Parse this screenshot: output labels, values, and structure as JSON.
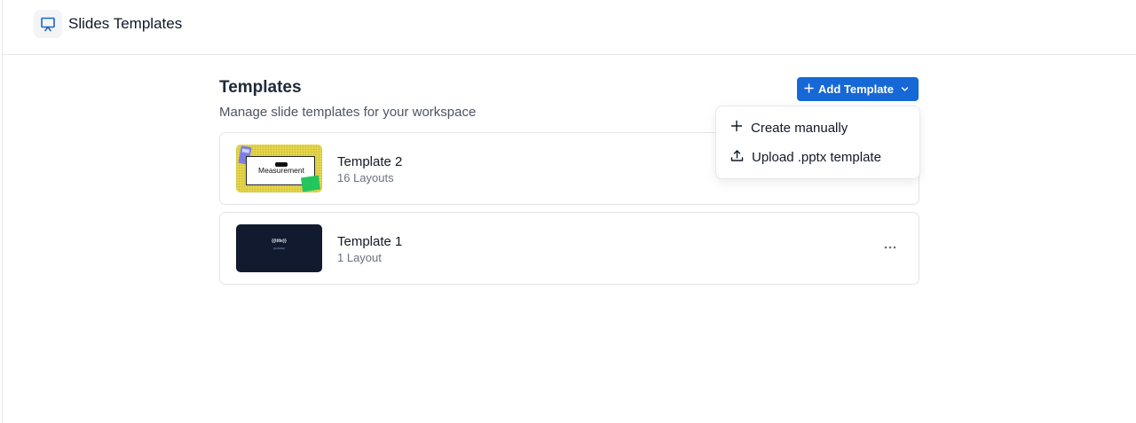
{
  "app": {
    "title": "Slides Templates",
    "icon": "presentation-icon"
  },
  "page": {
    "title": "Templates",
    "subtitle": "Manage slide templates for your workspace"
  },
  "add_button": {
    "label": "Add Template",
    "color": "#1668d6"
  },
  "dropdown": {
    "items": [
      {
        "label": "Create manually",
        "icon": "plus-icon"
      },
      {
        "label": "Upload .pptx template",
        "icon": "upload-icon"
      }
    ]
  },
  "templates": [
    {
      "name": "Template 2",
      "meta": "16 Layouts",
      "thumbnail": {
        "style": "yellow",
        "text": "Measurement"
      }
    },
    {
      "name": "Template 1",
      "meta": "1 Layout",
      "thumbnail": {
        "style": "dark",
        "text": "{{title}}",
        "subtext": "{{subtitle}}"
      }
    }
  ]
}
